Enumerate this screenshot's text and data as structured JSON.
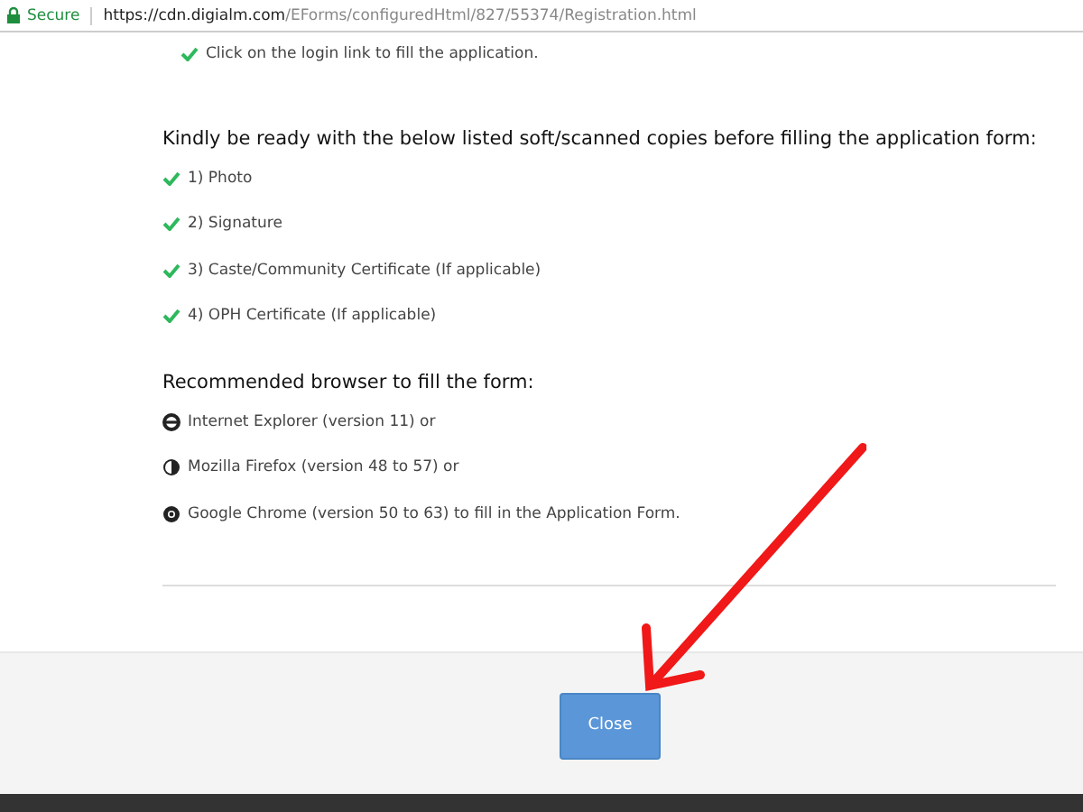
{
  "address_bar": {
    "secure_label": "Secure",
    "url_host": "https://cdn.digialm.com",
    "url_path": "/EForms/configuredHtml/827/55374/Registration.html"
  },
  "intro_item": "Click on the login link to fill the application.",
  "documents": {
    "heading": "Kindly be ready with the below listed soft/scanned copies before filling the application form:",
    "items": [
      {
        "text": "1) Photo"
      },
      {
        "text": "2) Signature"
      },
      {
        "text": "3) Caste/Community Certificate (If applicable)"
      },
      {
        "text": "4) OPH Certificate (If applicable)"
      }
    ]
  },
  "browsers": {
    "heading": "Recommended browser to fill the form:",
    "items": [
      {
        "kind": "ie",
        "text": "Internet Explorer (version 11) or"
      },
      {
        "kind": "firefox",
        "text": "Mozilla Firefox (version 48 to 57) or"
      },
      {
        "kind": "chrome",
        "text": "Google Chrome (version 50 to 63) to fill in the Application Form."
      }
    ]
  },
  "footer": {
    "button": "Close"
  }
}
